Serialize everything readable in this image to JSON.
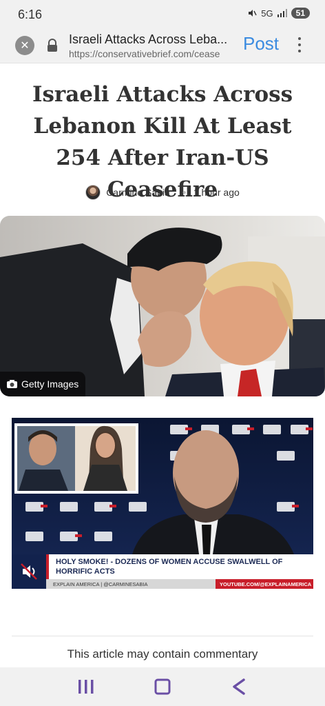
{
  "status_bar": {
    "time": "6:16",
    "network": "5G",
    "battery": "51"
  },
  "browser": {
    "page_title": "Israeli Attacks Across Leba...",
    "url": "https://conservativebrief.com/cease",
    "post_label": "Post",
    "accent": "#3b8be0"
  },
  "article": {
    "headline": "Israeli Attacks Across Lebanon Kill At Least 254 After Iran-US Ceasefire",
    "author": "Carmine Sabia",
    "published": "1 hour ago",
    "hero_credit": "Getty Images",
    "commentary_notice": "This article may contain commentary"
  },
  "video": {
    "headline": "HOLY SMOKE! - DOZENS OF WOMEN ACCUSE SWALWELL OF HORRIFIC ACTS",
    "ticker_left": "EXPLAIN AMERICA | @CARMINESABIA",
    "ticker_right": "YOUTUBE.COM/@EXPLAINAMERICA",
    "brand_red": "#c81e2a",
    "brand_navy": "#1c2a55"
  },
  "nav_bar": {
    "recents_icon": "recents-icon",
    "home_icon": "home-icon",
    "back_icon": "back-icon",
    "color": "#6a4fa5"
  }
}
